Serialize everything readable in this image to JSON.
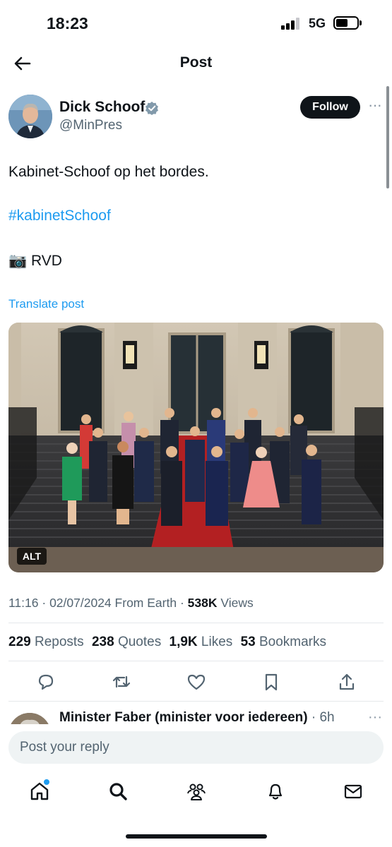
{
  "status_bar": {
    "time": "18:23",
    "network": "5G",
    "icons": [
      "signal-icon",
      "battery-icon"
    ]
  },
  "header": {
    "title": "Post",
    "back_icon": "arrow-left-icon"
  },
  "post": {
    "author": {
      "name": "Dick Schoof",
      "handle": "@MinPres",
      "verified": true
    },
    "follow_label": "Follow",
    "lines": {
      "text": "Kabinet-Schoof op het bordes.",
      "hashtag": "#kabinetSchoof",
      "camera_emoji": "📷",
      "credit": "RVD"
    },
    "translate_label": "Translate post",
    "image": {
      "alt_badge": "ALT"
    },
    "meta": {
      "time": "11:16",
      "separator": "·",
      "date": "02/07/2024",
      "source": "From Earth",
      "views_count": "538K",
      "views_label": "Views"
    },
    "stats": [
      {
        "count": "229",
        "label": "Reposts"
      },
      {
        "count": "238",
        "label": "Quotes"
      },
      {
        "count": "1,9K",
        "label": "Likes"
      },
      {
        "count": "53",
        "label": "Bookmarks"
      }
    ],
    "actions": [
      "reply-icon",
      "repost-icon",
      "like-icon",
      "bookmark-icon",
      "share-icon"
    ]
  },
  "reply_preview": {
    "author": "Minister Faber (minister voor iedereen)",
    "time": "· 6h"
  },
  "composer": {
    "placeholder": "Post your reply"
  },
  "tab_bar": [
    "home-icon",
    "search-icon",
    "communities-icon",
    "notifications-icon",
    "messages-icon"
  ],
  "colors": {
    "accent": "#1d9bf0",
    "text": "#0f1419",
    "muted": "#536471"
  }
}
